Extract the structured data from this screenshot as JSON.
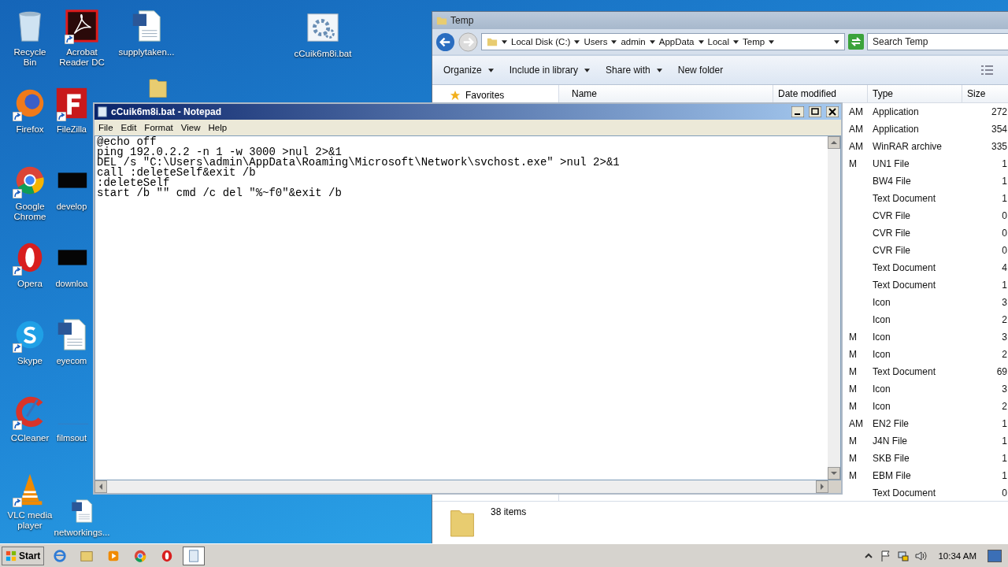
{
  "desktop_icons": [
    {
      "label": "Recycle Bin",
      "kind": "recycle",
      "shortcut": false
    },
    {
      "label": "Firefox",
      "kind": "firefox",
      "shortcut": true
    },
    {
      "label": "Google Chrome",
      "kind": "chrome",
      "shortcut": true
    },
    {
      "label": "Opera",
      "kind": "opera",
      "shortcut": true
    },
    {
      "label": "Skype",
      "kind": "skype",
      "shortcut": true
    },
    {
      "label": "CCleaner",
      "kind": "ccleaner",
      "shortcut": true
    },
    {
      "label": "VLC media player",
      "kind": "vlc",
      "shortcut": true
    },
    {
      "label": "Acrobat Reader DC",
      "kind": "pdf",
      "shortcut": true
    },
    {
      "label": "FileZilla",
      "kind": "filezilla",
      "shortcut": true
    },
    {
      "label": "develop",
      "kind": "dark",
      "shortcut": false
    },
    {
      "label": "downloa",
      "kind": "dark",
      "shortcut": false
    },
    {
      "label": "eyecom",
      "kind": "word",
      "shortcut": false
    },
    {
      "label": "filmsout",
      "kind": "blank",
      "shortcut": false
    },
    {
      "label": "networkings...",
      "kind": "word",
      "shortcut": false
    },
    {
      "label": "supplytaken...",
      "kind": "word",
      "shortcut": false
    },
    {
      "kind": "folder",
      "shortcut": false
    },
    {
      "label": "cCuik6m8i.bat",
      "kind": "batch",
      "shortcut": false
    }
  ],
  "explorer": {
    "title": "Temp",
    "breadcrumbs": [
      "Local Disk (C:)",
      "Users",
      "admin",
      "AppData",
      "Local",
      "Temp"
    ],
    "search": {
      "placeholder": "Search Temp"
    },
    "toolbar": [
      {
        "label": "Organize",
        "dropdown": true
      },
      {
        "label": "Include in library",
        "dropdown": true
      },
      {
        "label": "Share with",
        "dropdown": true
      },
      {
        "label": "New folder",
        "dropdown": false
      }
    ],
    "nav_items": [
      "Favorites"
    ],
    "columns": [
      "Name",
      "Date modified",
      "Type",
      "Size"
    ],
    "rows": [
      {
        "date": "AM",
        "type": "Application",
        "size": "272"
      },
      {
        "date": "AM",
        "type": "Application",
        "size": "354"
      },
      {
        "date": "AM",
        "type": "WinRAR archive",
        "size": "335"
      },
      {
        "date": "M",
        "type": "UN1 File",
        "size": "1"
      },
      {
        "date": "",
        "type": "BW4 File",
        "size": "1"
      },
      {
        "date": "",
        "type": "Text Document",
        "size": "1"
      },
      {
        "date": "",
        "type": "CVR File",
        "size": "0"
      },
      {
        "date": "",
        "type": "CVR File",
        "size": "0"
      },
      {
        "date": "",
        "type": "CVR File",
        "size": "0"
      },
      {
        "date": "",
        "type": "Text Document",
        "size": "4"
      },
      {
        "date": "",
        "type": "Text Document",
        "size": "1"
      },
      {
        "date": "",
        "type": "Icon",
        "size": "3"
      },
      {
        "date": "",
        "type": "Icon",
        "size": "2"
      },
      {
        "date": "M",
        "type": "Icon",
        "size": "3"
      },
      {
        "date": "M",
        "type": "Icon",
        "size": "2"
      },
      {
        "date": "M",
        "type": "Text Document",
        "size": "69"
      },
      {
        "date": "M",
        "type": "Icon",
        "size": "3"
      },
      {
        "date": "M",
        "type": "Icon",
        "size": "2"
      },
      {
        "date": "AM",
        "type": "EN2 File",
        "size": "1"
      },
      {
        "date": "M",
        "type": "J4N File",
        "size": "1"
      },
      {
        "date": "M",
        "type": "SKB File",
        "size": "1"
      },
      {
        "date": "M",
        "type": "EBM File",
        "size": "1"
      },
      {
        "date": "",
        "type": "Text Document",
        "size": "0"
      }
    ],
    "status": "38 items"
  },
  "notepad": {
    "title": "cCuik6m8i.bat - Notepad",
    "menu": [
      "File",
      "Edit",
      "Format",
      "View",
      "Help"
    ],
    "lines": [
      "@echo off",
      "ping 192.0.2.2 -n 1 -w 3000 >nul 2>&1",
      "DEL /s \"C:\\Users\\admin\\AppData\\Roaming\\Microsoft\\Network\\svchost.exe\" >nul 2>&1",
      "call :deleteSelf&exit /b",
      ":deleteSelf",
      "start /b \"\" cmd /c del \"%~f0\"&exit /b"
    ]
  },
  "taskbar": {
    "start": "Start",
    "pinned": [
      {
        "kind": "ie",
        "selected": false
      },
      {
        "kind": "explorer",
        "selected": false
      },
      {
        "kind": "media",
        "selected": false
      },
      {
        "kind": "chrome",
        "selected": false
      },
      {
        "kind": "opera",
        "selected": false
      },
      {
        "kind": "notepad",
        "selected": true
      }
    ],
    "clock": "10:34 AM"
  }
}
